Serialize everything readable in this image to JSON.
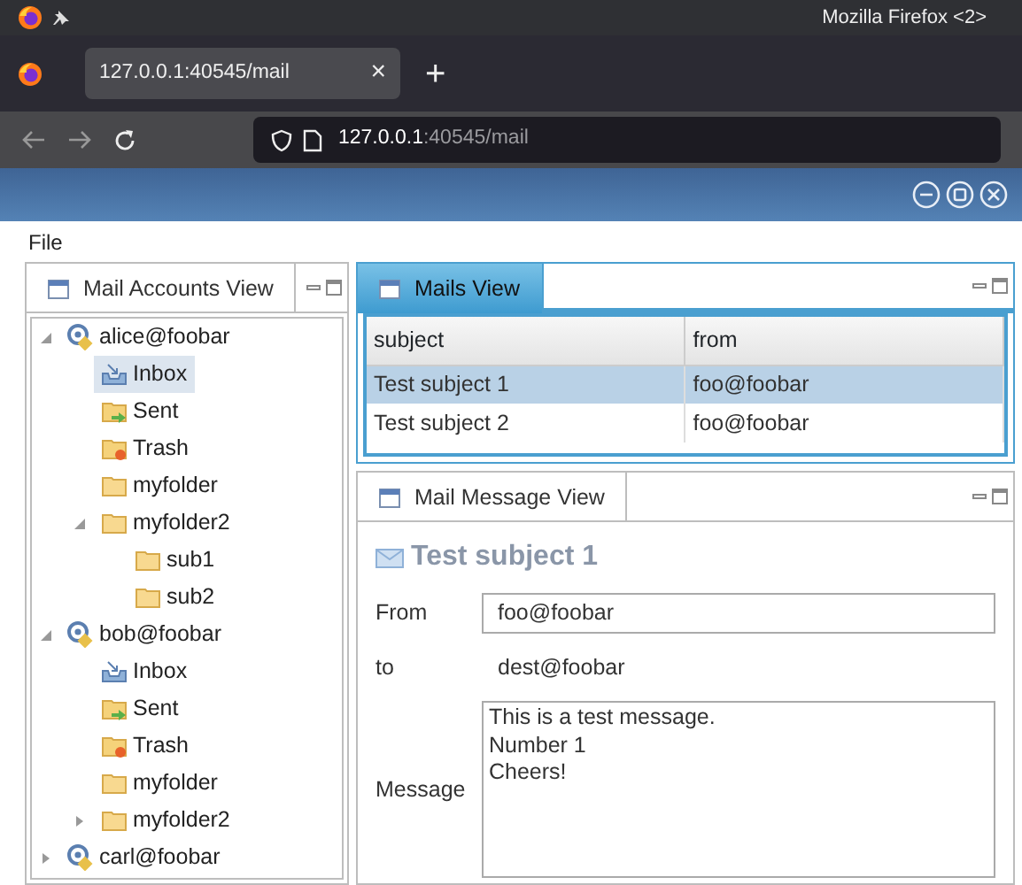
{
  "browser": {
    "window_title": "Mozilla Firefox <2>",
    "tab": {
      "title": "127.0.0.1:40545/mail",
      "close": "×"
    },
    "new_tab": "+",
    "url": {
      "host": "127.0.0.1",
      "path": ":40545/mail"
    }
  },
  "menu": [
    "File"
  ],
  "accounts_view": {
    "title": "Mail Accounts View",
    "active": false,
    "tree": [
      {
        "label": "alice@foobar",
        "kind": "account",
        "expanded": true,
        "selected": false,
        "children": [
          {
            "label": "Inbox",
            "kind": "inbox",
            "selected": true
          },
          {
            "label": "Sent",
            "kind": "sent",
            "selected": false
          },
          {
            "label": "Trash",
            "kind": "trash",
            "selected": false
          },
          {
            "label": "myfolder",
            "kind": "folder",
            "selected": false
          },
          {
            "label": "myfolder2",
            "kind": "folder",
            "expanded": true,
            "selected": false,
            "children": [
              {
                "label": "sub1",
                "kind": "folder",
                "selected": false
              },
              {
                "label": "sub2",
                "kind": "folder",
                "selected": false
              }
            ]
          }
        ]
      },
      {
        "label": "bob@foobar",
        "kind": "account",
        "expanded": true,
        "selected": false,
        "children": [
          {
            "label": "Inbox",
            "kind": "inbox",
            "selected": false
          },
          {
            "label": "Sent",
            "kind": "sent",
            "selected": false
          },
          {
            "label": "Trash",
            "kind": "trash",
            "selected": false
          },
          {
            "label": "myfolder",
            "kind": "folder",
            "selected": false
          },
          {
            "label": "myfolder2",
            "kind": "folder",
            "expanded": false,
            "selected": false
          }
        ]
      },
      {
        "label": "carl@foobar",
        "kind": "account",
        "expanded": false,
        "selected": false
      }
    ]
  },
  "mails_view": {
    "title": "Mails View",
    "active": true,
    "columns": [
      "subject",
      "from"
    ],
    "rows": [
      {
        "cells": [
          "Test subject 1",
          "foo@foobar"
        ],
        "selected": true
      },
      {
        "cells": [
          "Test subject 2",
          "foo@foobar"
        ],
        "selected": false
      }
    ]
  },
  "message_view": {
    "title": "Mail Message View",
    "active": false,
    "subject": "Test subject 1",
    "fields": [
      {
        "label": "From",
        "kind": "field",
        "value": "foo@foobar"
      },
      {
        "label": "to",
        "kind": "text",
        "value": "dest@foobar"
      },
      {
        "label": "Message",
        "kind": "area",
        "value": "This is a test message.\nNumber 1\nCheers!"
      }
    ]
  }
}
